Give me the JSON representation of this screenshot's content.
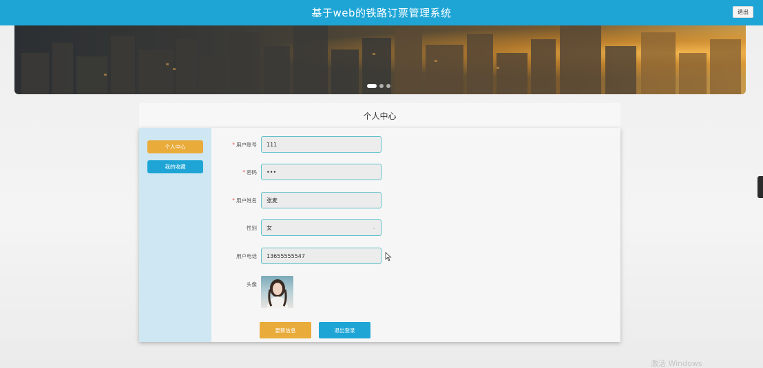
{
  "header": {
    "title": "基于web的铁路订票管理系统",
    "logout_label": "退出",
    "bg_color": "#1ea5d6"
  },
  "banner": {
    "slides_count": 3,
    "active_slide": 1
  },
  "page": {
    "title": "个人中心"
  },
  "sidebar": {
    "items": [
      {
        "label": "个人中心",
        "color": "#e9ab3a",
        "active": true
      },
      {
        "label": "我的收藏",
        "color": "#1ea5d6",
        "active": false
      }
    ]
  },
  "form": {
    "account": {
      "label": "用户账号",
      "required": true,
      "value": "111"
    },
    "password": {
      "label": "密码",
      "required": true,
      "value": "•••"
    },
    "name": {
      "label": "用户姓名",
      "required": true,
      "value": "张麦"
    },
    "gender": {
      "label": "性别",
      "required": false,
      "value": "女"
    },
    "phone": {
      "label": "用户电话",
      "required": false,
      "value": "13655555547"
    },
    "avatar": {
      "label": "头像"
    },
    "required_mark": "*"
  },
  "actions": {
    "update_label": "更新信息",
    "logout_label": "退出登录"
  },
  "watermark": "激活 Windows"
}
